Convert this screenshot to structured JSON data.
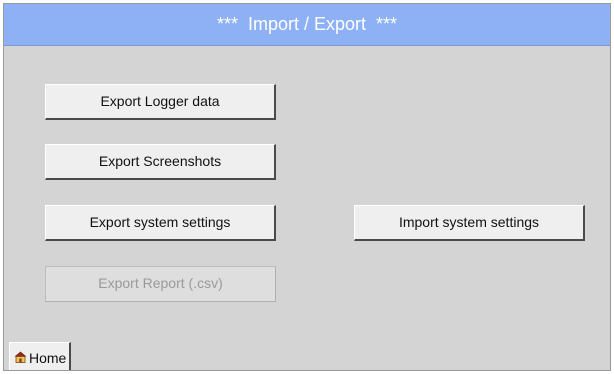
{
  "header": {
    "title": "***  Import / Export  ***"
  },
  "buttons": {
    "export_logger": "Export Logger data",
    "export_screenshots": "Export Screenshots",
    "export_system_settings": "Export system settings",
    "import_system_settings": "Import system settings",
    "export_report": "Export Report (.csv)"
  },
  "states": {
    "export_report_enabled": false
  },
  "nav": {
    "home_label": "Home",
    "home_icon": "house-icon"
  },
  "colors": {
    "title_bar": "#8db1f4",
    "background": "#d4d4d4",
    "button_face": "#efefef",
    "disabled_text": "#9a9a9a"
  }
}
